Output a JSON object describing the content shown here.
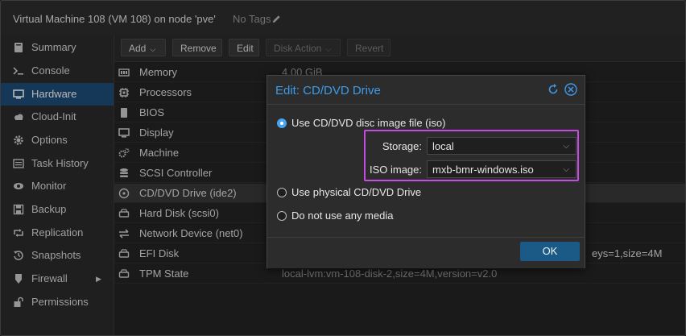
{
  "header": {
    "vm_title": "Virtual Machine 108 (VM 108) on node 'pve'",
    "tags": "No Tags"
  },
  "sidebar": {
    "items": [
      {
        "label": "Summary",
        "icon": "book-icon"
      },
      {
        "label": "Console",
        "icon": "terminal-icon"
      },
      {
        "label": "Hardware",
        "icon": "monitor-icon",
        "active": true
      },
      {
        "label": "Cloud-Init",
        "icon": "cloud-icon"
      },
      {
        "label": "Options",
        "icon": "gear-icon"
      },
      {
        "label": "Task History",
        "icon": "list-icon"
      },
      {
        "label": "Monitor",
        "icon": "eye-icon"
      },
      {
        "label": "Backup",
        "icon": "floppy-icon"
      },
      {
        "label": "Replication",
        "icon": "retweet-icon"
      },
      {
        "label": "Snapshots",
        "icon": "history-icon"
      },
      {
        "label": "Firewall",
        "icon": "shield-icon"
      },
      {
        "label": "Permissions",
        "icon": "unlock-icon"
      }
    ]
  },
  "toolbar": {
    "add": "Add",
    "remove": "Remove",
    "edit": "Edit",
    "disk_action": "Disk Action",
    "revert": "Revert"
  },
  "hardware": {
    "rows": [
      {
        "name": "Memory",
        "value": "4.00 GiB"
      },
      {
        "name": "Processors",
        "value": ""
      },
      {
        "name": "BIOS",
        "value": ""
      },
      {
        "name": "Display",
        "value": ""
      },
      {
        "name": "Machine",
        "value": ""
      },
      {
        "name": "SCSI Controller",
        "value": ""
      },
      {
        "name": "CD/DVD Drive (ide2)",
        "value": ""
      },
      {
        "name": "Hard Disk (scsi0)",
        "value": ""
      },
      {
        "name": "Network Device (net0)",
        "value": ""
      },
      {
        "name": "EFI Disk",
        "value": "eys=1,size=4M"
      },
      {
        "name": "TPM State",
        "value": "local-lvm:vm-108-disk-2,size=4M,version=v2.0"
      }
    ]
  },
  "dialog": {
    "title": "Edit: CD/DVD Drive",
    "opt_iso": "Use CD/DVD disc image file (iso)",
    "storage_label": "Storage:",
    "storage_value": "local",
    "iso_label": "ISO image:",
    "iso_value": "mxb-bmr-windows.iso",
    "opt_physical": "Use physical CD/DVD Drive",
    "opt_none": "Do not use any media",
    "ok": "OK"
  },
  "colors": {
    "accent": "#3d9bea",
    "active_nav": "#1f4e7a",
    "highlight": "#c74be2",
    "ok_button": "#1b5a87"
  }
}
